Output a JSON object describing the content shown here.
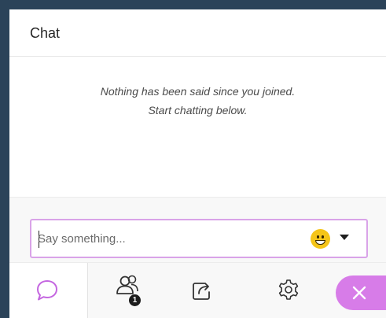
{
  "header": {
    "title": "Chat"
  },
  "messages": {
    "empty_line1": "Nothing has been said since you joined.",
    "empty_line2": "Start chatting below."
  },
  "compose": {
    "placeholder": "Say something...",
    "value": "",
    "emoji_icon": "smiley-emoji-icon",
    "dropdown_icon": "caret-down-icon"
  },
  "toolbar": {
    "items": [
      {
        "icon": "chat-bubble-icon",
        "active": true
      },
      {
        "icon": "attendees-icon",
        "badge": "1"
      },
      {
        "icon": "share-content-icon"
      },
      {
        "icon": "settings-gear-icon"
      },
      {
        "icon": "close-icon"
      }
    ]
  },
  "colors": {
    "accent": "#d77ce8",
    "input_border": "#d9a3e8",
    "frame": "#2b4359"
  }
}
